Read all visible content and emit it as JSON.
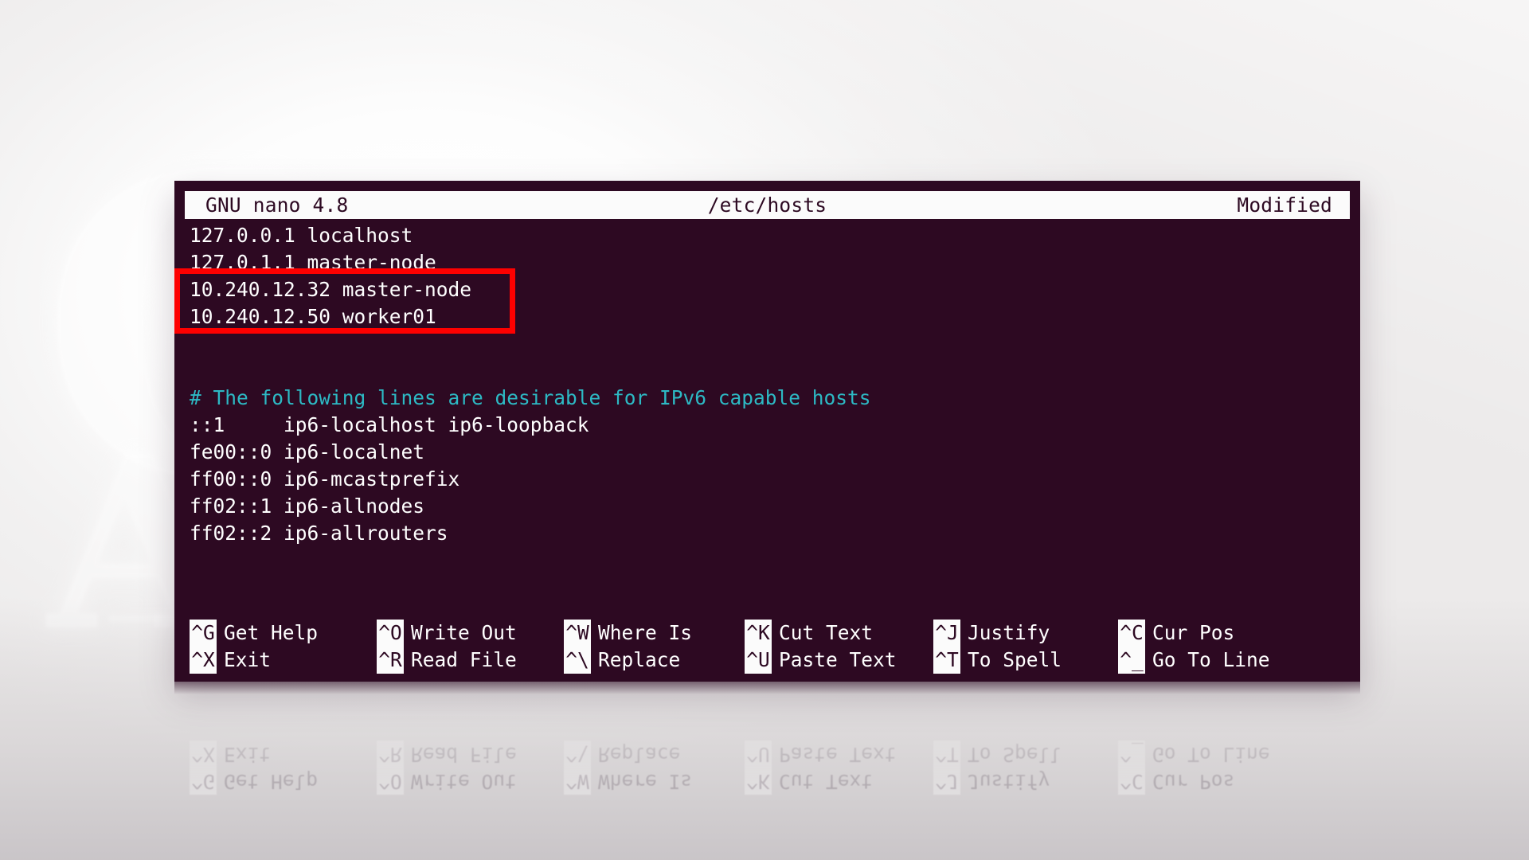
{
  "window": {
    "app_title": "GNU nano 4.8",
    "file_path": "/etc/hosts",
    "status": "Modified"
  },
  "editor": {
    "lines": [
      {
        "text": "127.0.0.1 localhost",
        "kind": "plain",
        "highlighted": false
      },
      {
        "text": "127.0.1.1 master-node",
        "kind": "plain",
        "highlighted": false
      },
      {
        "text": "10.240.12.32 master-node",
        "kind": "plain",
        "highlighted": true
      },
      {
        "text": "10.240.12.50 worker01",
        "kind": "plain",
        "highlighted": true
      },
      {
        "text": "",
        "kind": "blank",
        "highlighted": false
      },
      {
        "text": "",
        "kind": "blank",
        "highlighted": false
      },
      {
        "text": "# The following lines are desirable for IPv6 capable hosts",
        "kind": "comment",
        "highlighted": false
      },
      {
        "text": "::1     ip6-localhost ip6-loopback",
        "kind": "plain",
        "highlighted": false
      },
      {
        "text": "fe00::0 ip6-localnet",
        "kind": "plain",
        "highlighted": false
      },
      {
        "text": "ff00::0 ip6-mcastprefix",
        "kind": "plain",
        "highlighted": false
      },
      {
        "text": "ff02::1 ip6-allnodes",
        "kind": "plain",
        "highlighted": false
      },
      {
        "text": "ff02::2 ip6-allrouters",
        "kind": "plain",
        "highlighted": false
      }
    ]
  },
  "shortcuts": {
    "row1": [
      {
        "key": "^G",
        "label": "Get Help"
      },
      {
        "key": "^O",
        "label": "Write Out"
      },
      {
        "key": "^W",
        "label": "Where Is"
      },
      {
        "key": "^K",
        "label": "Cut Text"
      },
      {
        "key": "^J",
        "label": "Justify"
      },
      {
        "key": "^C",
        "label": "Cur Pos"
      }
    ],
    "row2": [
      {
        "key": "^X",
        "label": "Exit"
      },
      {
        "key": "^R",
        "label": "Read File"
      },
      {
        "key": "^\\",
        "label": "Replace"
      },
      {
        "key": "^U",
        "label": "Paste Text"
      },
      {
        "key": "^T",
        "label": "To Spell"
      },
      {
        "key": "^_",
        "label": "Go To Line"
      }
    ]
  },
  "annotation": {
    "color": "#fe0000",
    "covers": [
      "10.240.12.32 master-node",
      "10.240.12.50 worker01"
    ]
  },
  "colors": {
    "terminal_background": "#2d0922",
    "terminal_foreground": "#ffffff",
    "titlebar_background": "#fbfbfb",
    "comment": "#2db9c4",
    "annotation_red": "#fe0000",
    "page_background": "#f2f1f1"
  },
  "watermark": {
    "glyph_primary": "C",
    "glyph_secondary": "A",
    "glyph_tail": "——"
  }
}
